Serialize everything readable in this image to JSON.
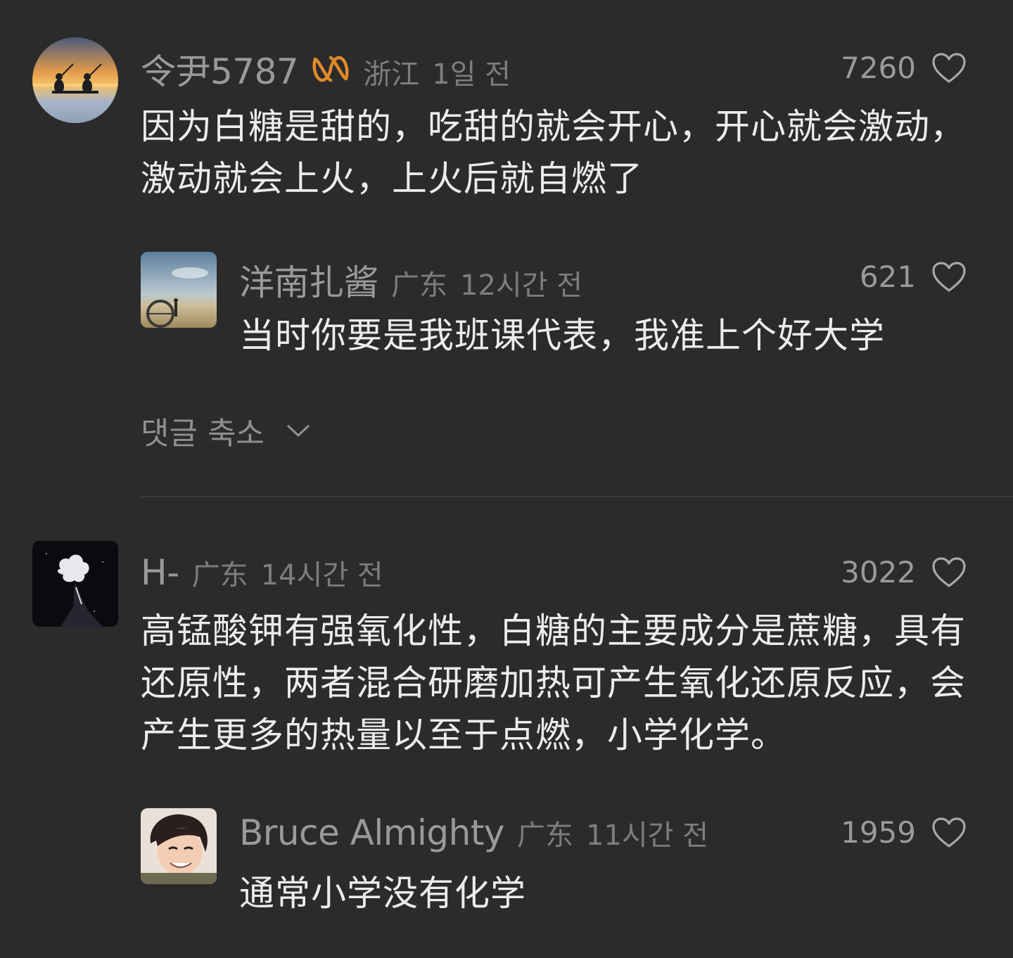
{
  "comments": [
    {
      "username": "令尹5787",
      "location": "浙江",
      "time": "1일 전",
      "likes": "7260",
      "text": "因为白糖是甜的，吃甜的就会开心，开心就会激动，激动就会上火，上火后就自燃了",
      "reply": {
        "username": "洋南扎酱",
        "location": "广东",
        "time": "12시간 전",
        "likes": "621",
        "text": "当时你要是我班课代表，我准上个好大学"
      },
      "collapse_label": "댓글 축소"
    },
    {
      "username": "H-",
      "location": "广东",
      "time": "14시간 전",
      "likes": "3022",
      "text": "高锰酸钾有强氧化性，白糖的主要成分是蔗糖，具有还原性，两者混合研磨加热可产生氧化还原反应，会产生更多的热量以至于点燃，小学化学。",
      "reply": {
        "username": "Bruce Almighty",
        "location": "广东",
        "time": "11시간 전",
        "likes": "1959",
        "text": "通常小学没有化学"
      }
    }
  ],
  "colors": {
    "background": "#2b2b2c",
    "badge": "#e08a2a"
  }
}
